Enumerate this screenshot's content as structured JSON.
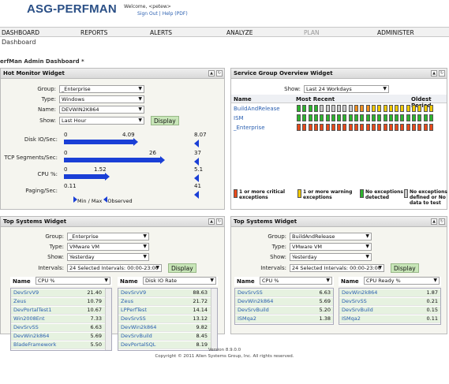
{
  "header": {
    "logo": "ASG-PERFMAN",
    "welcome": "Welcome, <petew>",
    "signout": "Sign Out | Help (PDF)"
  },
  "nav": [
    "DASHBOARD",
    "REPORTS",
    "ALERTS",
    "ANALYZE",
    "PLAN",
    "ADMINISTER"
  ],
  "breadcrumb": "Dashboard",
  "page_title": "erfMan Admin Dashboard *",
  "hot": {
    "title": "Hot Monitor Widget",
    "group_label": "Group:",
    "group": "_Enterprise",
    "type_label": "Type:",
    "type": "Windows",
    "name_label": "Name:",
    "name": "DEVWIN2K864",
    "show_label": "Show:",
    "show": "Last Hour",
    "display": "Display",
    "metrics": [
      {
        "label": "Disk IO/Sec:",
        "min": "0",
        "observed": "4.09",
        "max": "8.07",
        "fraction": 0.507
      },
      {
        "label": "TCP Segments/Sec:",
        "min": "0",
        "observed": "26",
        "max": "37",
        "fraction": 0.703
      },
      {
        "label": "CPU %:",
        "min": "0",
        "observed": "1.52",
        "max": "5.1",
        "fraction": 0.298
      },
      {
        "label": "Paging/Sec:",
        "min": "0.11",
        "observed": "",
        "max": "41",
        "fraction": 0.003
      }
    ],
    "legend_min": "Min / Max",
    "legend_obs": "Observed"
  },
  "sgo": {
    "title": "Service Group Overview Widget",
    "show_label": "Show:",
    "show": "Last 24 Workdays",
    "col_name": "Name",
    "col_recent": "Most Recent",
    "col_oldest": "Oldest Period",
    "rows": [
      {
        "name": "BuildAndRelease",
        "cells": [
          "g",
          "g",
          "g",
          "g",
          "w",
          "w",
          "w",
          "w",
          "w",
          "w",
          "o",
          "o",
          "o",
          "y",
          "y",
          "y",
          "y",
          "y",
          "y",
          "y",
          "y",
          "y",
          "y",
          "y"
        ]
      },
      {
        "name": "ISM",
        "cells": [
          "g",
          "g",
          "g",
          "g",
          "g",
          "g",
          "g",
          "g",
          "g",
          "g",
          "g",
          "g",
          "g",
          "g",
          "g",
          "g",
          "g",
          "g",
          "g",
          "g",
          "g",
          "g",
          "g",
          "g"
        ]
      },
      {
        "name": "_Enterprise",
        "cells": [
          "r",
          "r",
          "r",
          "r",
          "r",
          "r",
          "r",
          "r",
          "r",
          "r",
          "r",
          "r",
          "r",
          "r",
          "r",
          "r",
          "r",
          "r",
          "r",
          "r",
          "r",
          "r",
          "r",
          "r"
        ]
      }
    ],
    "legend": [
      {
        "text": "1 or more critical exceptions",
        "color": "#e84a1a"
      },
      {
        "text": "1 or more warning exceptions",
        "color": "#f0c800"
      },
      {
        "text": "No exceptions detected",
        "color": "#2db52d"
      },
      {
        "text": "No exceptions defined or No data to test",
        "color": "#c8c8c8"
      }
    ]
  },
  "top1": {
    "title": "Top Systems Widget",
    "group_label": "Group:",
    "group": "_Enterprise",
    "type_label": "Type:",
    "type": "VMware VM",
    "show_label": "Show:",
    "show": "Yesterday",
    "int_label": "Intervals:",
    "intervals": "24 Selected Intervals: 00:00-23:00",
    "display": "Display",
    "left": {
      "name_h": "Name",
      "metric": "CPU %",
      "rows": [
        [
          "DevSrvV9",
          "21.40"
        ],
        [
          "Zeus",
          "10.79"
        ],
        [
          "DevPortalTest1",
          "10.67"
        ],
        [
          "Win2008Ent",
          "7.33"
        ],
        [
          "DevSrvSS",
          "6.63"
        ],
        [
          "DevWin2k864",
          "5.69"
        ],
        [
          "BladeFramework",
          "5.50"
        ]
      ]
    },
    "right": {
      "name_h": "Name",
      "metric": "Disk IO Rate",
      "rows": [
        [
          "DevSrvV9",
          "88.63"
        ],
        [
          "Zeus",
          "21.72"
        ],
        [
          "LPPerfTest",
          "14.14"
        ],
        [
          "DevSrvSS",
          "13.12"
        ],
        [
          "DevWin2k864",
          "9.82"
        ],
        [
          "DevSrvBuild",
          "8.45"
        ],
        [
          "DevPortalSQL",
          "8.19"
        ]
      ]
    }
  },
  "top2": {
    "title": "Top Systems Widget",
    "group_label": "Group:",
    "group": "BuildAndRelease",
    "type_label": "Type:",
    "type": "VMware VM",
    "show_label": "Show:",
    "show": "Yesterday",
    "int_label": "Intervals:",
    "intervals": "24 Selected Intervals: 00:00-23:00",
    "display": "Display",
    "left": {
      "name_h": "Name",
      "metric": "CPU %",
      "rows": [
        [
          "DevSrvSS",
          "6.63"
        ],
        [
          "DevWin2k864",
          "5.69"
        ],
        [
          "DevSrvBuild",
          "5.20"
        ],
        [
          "ISMqa2",
          "1.38"
        ]
      ]
    },
    "right": {
      "name_h": "Name",
      "metric": "CPU Ready %",
      "rows": [
        [
          "DevWin2k864",
          "1.87"
        ],
        [
          "DevSrvSS",
          "0.21"
        ],
        [
          "DevSrvBuild",
          "0.15"
        ],
        [
          "ISMqa2",
          "0.11"
        ]
      ]
    }
  },
  "footer": {
    "version": "Version 8.9.0.0",
    "copyright": "Copyright © 2011 Allen Systems Group, Inc. All rights reserved."
  },
  "colors": {
    "g": "#2db52d",
    "r": "#e84a1a",
    "w": "#c8c8c8",
    "y": "#f0c800",
    "o": "#f09020",
    "bar": "#1a3fd6",
    "link": "#2a5fb0"
  }
}
